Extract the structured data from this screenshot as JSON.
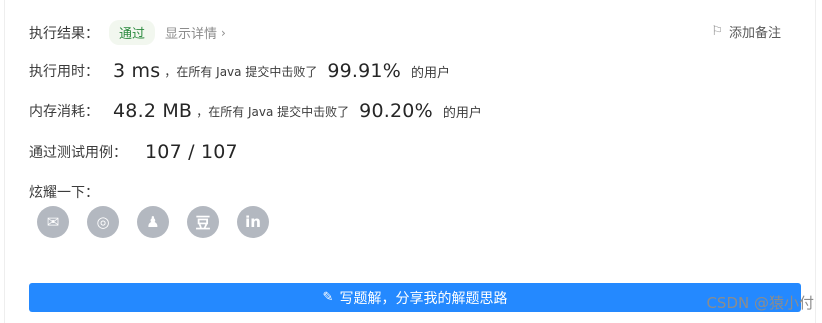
{
  "result": {
    "label": "执行结果：",
    "status": "通过",
    "detail_link": "显示详情",
    "add_note": "添加备注"
  },
  "runtime": {
    "label": "执行用时：",
    "value": "3 ms",
    "prefix": "，在所有 Java 提交中击败了",
    "percent": "99.91%",
    "suffix": "的用户"
  },
  "memory": {
    "label": "内存消耗：",
    "value": "48.2 MB",
    "prefix": "，在所有 Java 提交中击败了",
    "percent": "90.20%",
    "suffix": "的用户"
  },
  "testcases": {
    "label": "通过测试用例：",
    "value": "107 / 107"
  },
  "share": {
    "label": "炫耀一下：",
    "icons": [
      "wechat-icon",
      "weibo-icon",
      "qq-icon",
      "douban-icon",
      "linkedin-icon"
    ],
    "glyphs": [
      "✉",
      "◎",
      "♟",
      "豆",
      "in"
    ]
  },
  "solution_button": "写题解，分享我的解题思路",
  "watermark": "CSDN @猿小付",
  "colors": {
    "accent": "#2489ff",
    "success": "#2b8a3e",
    "share_icon_bg": "#b3b8c0"
  }
}
